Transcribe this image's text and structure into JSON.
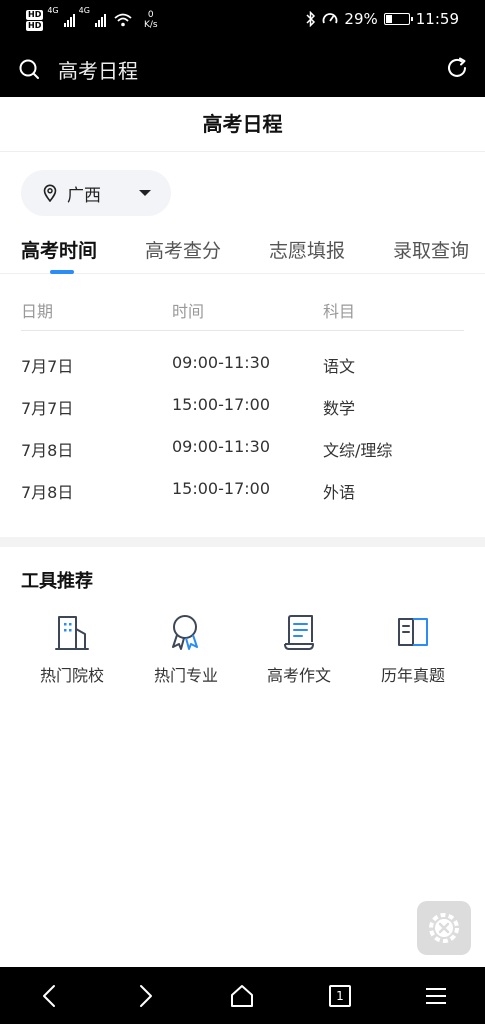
{
  "status_bar": {
    "hd1": "HD",
    "hd2": "HD",
    "net1": "4G",
    "net2": "4G",
    "speed_value": "0",
    "speed_unit": "K/s",
    "battery_pct": "29%",
    "battery_level": 0.29,
    "time": "11:59"
  },
  "search_bar": {
    "query": "高考日程"
  },
  "page": {
    "title": "高考日程"
  },
  "region": {
    "selected": "广西"
  },
  "tabs": [
    {
      "label": "高考时间",
      "active": true
    },
    {
      "label": "高考查分",
      "active": false
    },
    {
      "label": "志愿填报",
      "active": false
    },
    {
      "label": "录取查询",
      "active": false
    }
  ],
  "schedule": {
    "headers": [
      "日期",
      "时间",
      "科目"
    ],
    "rows": [
      {
        "date": "7月7日",
        "time": "09:00-11:30",
        "subject": "语文"
      },
      {
        "date": "7月7日",
        "time": "15:00-17:00",
        "subject": "数学"
      },
      {
        "date": "7月8日",
        "time": "09:00-11:30",
        "subject": "文综/理综"
      },
      {
        "date": "7月8日",
        "time": "15:00-17:00",
        "subject": "外语"
      }
    ]
  },
  "tools": {
    "title": "工具推荐",
    "items": [
      {
        "label": "热门院校",
        "icon": "building-icon"
      },
      {
        "label": "热门专业",
        "icon": "award-ribbon-icon"
      },
      {
        "label": "高考作文",
        "icon": "scroll-document-icon"
      },
      {
        "label": "历年真题",
        "icon": "open-book-icon"
      }
    ]
  },
  "bottom_nav": {
    "tab_count": "1"
  },
  "colors": {
    "accent": "#2b8cf5",
    "bar_bg": "#000000",
    "tool_stroke": "#3d4757"
  }
}
